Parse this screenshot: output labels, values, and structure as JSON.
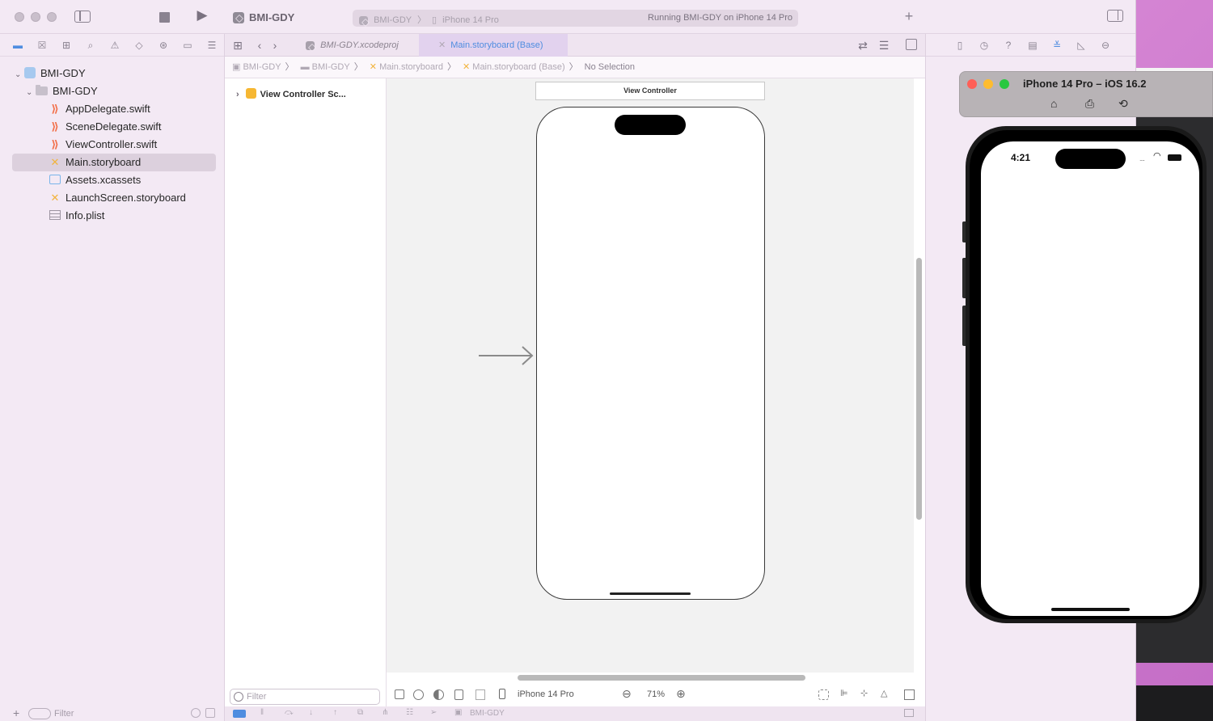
{
  "toolbar": {
    "project_name": "BMI-GDY",
    "scheme": "BMI-GDY",
    "destination": "iPhone 14 Pro",
    "status": "Running BMI-GDY on iPhone 14 Pro"
  },
  "navigator": {
    "items": [
      {
        "label": "BMI-GDY",
        "kind": "project"
      },
      {
        "label": "BMI-GDY",
        "kind": "group"
      },
      {
        "label": "AppDelegate.swift",
        "kind": "swift"
      },
      {
        "label": "SceneDelegate.swift",
        "kind": "swift"
      },
      {
        "label": "ViewController.swift",
        "kind": "swift"
      },
      {
        "label": "Main.storyboard",
        "kind": "storyboard",
        "selected": true
      },
      {
        "label": "Assets.xcassets",
        "kind": "assets"
      },
      {
        "label": "LaunchScreen.storyboard",
        "kind": "storyboard"
      },
      {
        "label": "Info.plist",
        "kind": "plist"
      }
    ],
    "filter_placeholder": "Filter"
  },
  "editor": {
    "tabs": [
      {
        "label": "BMI-GDY.xcodeproj",
        "active": false
      },
      {
        "label": "Main.storyboard (Base)",
        "active": true
      }
    ],
    "jumpbar": [
      "BMI-GDY",
      "BMI-GDY",
      "Main.storyboard",
      "Main.storyboard (Base)",
      "No Selection"
    ],
    "outline_item": "View Controller Sc...",
    "outline_filter_placeholder": "Filter",
    "scene_title": "View Controller",
    "device_config": "iPhone 14 Pro",
    "zoom": "71%",
    "debug_bar_target": "BMI-GDY"
  },
  "simulator": {
    "title": "iPhone 14 Pro – iOS 16.2",
    "time": "4:21"
  },
  "colors": {
    "accent": "#4f8de0",
    "close": "#ff5f57",
    "minimize": "#febc2e",
    "zoom": "#28c840"
  }
}
